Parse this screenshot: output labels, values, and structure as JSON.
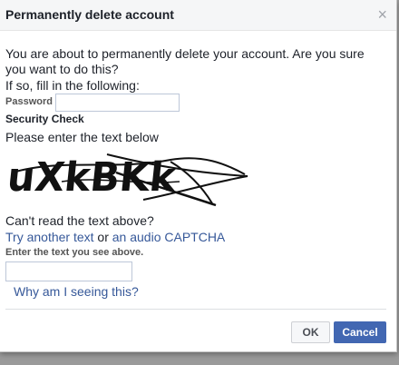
{
  "dialog": {
    "title": "Permanently delete account",
    "close_glyph": "×",
    "intro": "You are about to permanently delete your account. Are you sure you want to do this?",
    "if_so": "If so, fill in the following:",
    "password_label": "Password",
    "password_value": "",
    "security_check": "Security Check",
    "please_enter": "Please enter the text below",
    "captcha_text": "uXkBKk",
    "cant_read": "Can't read the text above?",
    "try_another": "Try another text",
    "or": " or ",
    "audio_captcha": "an audio CAPTCHA",
    "enter_label": "Enter the text you see above.",
    "captcha_input_value": "",
    "why_link": "Why am I seeing this?",
    "ok_label": "OK",
    "cancel_label": "Cancel"
  },
  "colors": {
    "link": "#365899",
    "primary_button": "#4267b2",
    "header_bg": "#f5f6f7"
  }
}
